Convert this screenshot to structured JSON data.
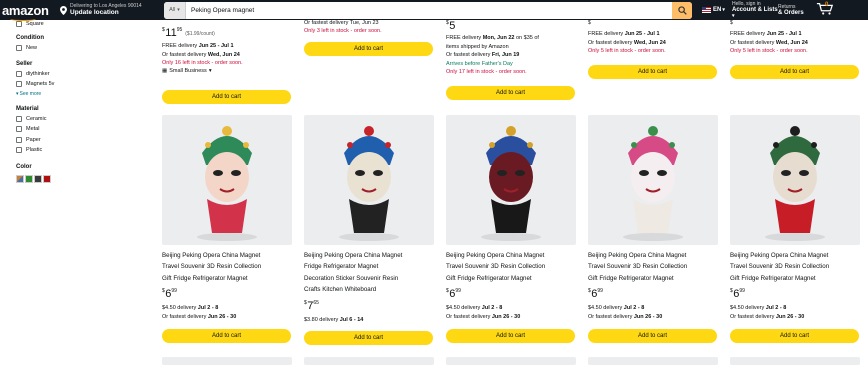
{
  "header": {
    "logo": "amazon",
    "deliver_line1": "Delivering to Los Angeles 90014",
    "deliver_line2": "Update location",
    "search_category": "All",
    "search_value": "Peking Opera magnet",
    "lang": "EN",
    "account_small": "Hello, sign in",
    "account_bold": "Account & Lists",
    "returns_small": "Returns",
    "returns_bold": "& Orders",
    "cart_count": "0"
  },
  "sidebar": {
    "top_item": "Square",
    "condition_heading": "Condition",
    "condition_items": [
      "New"
    ],
    "seller_heading": "Seller",
    "seller_items": [
      "diythinker",
      "Magnets 5v"
    ],
    "see_more": "See more",
    "material_heading": "Material",
    "material_items": [
      "Ceramic",
      "Metal",
      "Paper",
      "Plastic"
    ],
    "color_heading": "Color",
    "colors": [
      "#4a6fa5",
      "#2e8b2e",
      "#3a3a3a",
      "#b01010"
    ]
  },
  "top_row": [
    {
      "price_whole": "11",
      "price_frac": "95",
      "unit_price": "($1.99/count)",
      "line1": "FREE delivery ",
      "line1_bold": "Jun 25 - Jul 1",
      "line2": "Or fastest delivery ",
      "line2_bold": "Wed, Jun 24",
      "stock": "Only 16 left in stock - order soon.",
      "small_business": "Small Business",
      "button": "Add to cart"
    },
    {
      "partial_line": "Or fastest delivery Tue, Jun 23",
      "stock": "Only 3 left in stock - order soon.",
      "button": "Add to cart"
    },
    {
      "line1": "FREE delivery ",
      "line1_bold": "Mon, Jun 22",
      "line1_rest": " on $35 of",
      "line1b": "items shipped by Amazon",
      "line2": "Or fastest delivery ",
      "line2_bold": "Fri, Jun 19",
      "promo": "Arrives before Father's Day",
      "stock": "Only 17 left in stock - order soon.",
      "button": "Add to cart"
    },
    {
      "line1": "FREE delivery ",
      "line1_bold": "Jun 25 - Jul 1",
      "line2": "Or fastest delivery ",
      "line2_bold": "Wed, Jun 24",
      "stock": "Only 5 left in stock - order soon.",
      "button": "Add to cart"
    },
    {
      "line1": "FREE delivery ",
      "line1_bold": "Jun 25 - Jul 1",
      "line2": "Or fastest delivery ",
      "line2_bold": "Wed, Jun 24",
      "stock": "Only 5 left in stock - order soon.",
      "button": "Add to cart"
    }
  ],
  "products": [
    {
      "title_lines": [
        "Beijing Peking Opera China Magnet",
        "Travel Souvenir 3D Resin Collection",
        "Gift Fridge Refrigerator Magnet"
      ],
      "price_whole": "6",
      "price_frac": "99",
      "delivery": "$4.50 delivery ",
      "delivery_bold": "Jul 2 - 8",
      "fast": "Or fastest delivery ",
      "fast_bold": "Jun 26 - 30",
      "button": "Add to cart",
      "mask": {
        "face": "#f3d6c8",
        "hat": "#2f8a5a",
        "body": "#d2334b",
        "accent": "#e7b93c"
      }
    },
    {
      "title_lines": [
        "Beijing Peking Opera China Magnet",
        "Fridge Refrigerator Magnet",
        "Decoration Sticker Souvenir Resin",
        "Crafts Kitchen Whiteboard"
      ],
      "price_whole": "7",
      "price_frac": "65",
      "delivery": "$3.80 delivery ",
      "delivery_bold": "Jul 6 - 14",
      "button": "Add to cart",
      "mask": {
        "face": "#e9e2d2",
        "hat": "#1f5fae",
        "body": "#222222",
        "accent": "#c6232b"
      }
    },
    {
      "title_lines": [
        "Beijing Peking Opera China Magnet",
        "Travel Souvenir 3D Resin Collection",
        "Gift Fridge Refrigerator Magnet"
      ],
      "price_whole": "6",
      "price_frac": "99",
      "delivery": "$4.50 delivery ",
      "delivery_bold": "Jul 2 - 8",
      "fast": "Or fastest delivery ",
      "fast_bold": "Jun 26 - 30",
      "button": "Add to cart",
      "mask": {
        "face": "#6a1a22",
        "hat": "#2a4f9e",
        "body": "#181818",
        "accent": "#d4a22b"
      }
    },
    {
      "title_lines": [
        "Beijing Peking Opera China Magnet",
        "Travel Souvenir 3D Resin Collection",
        "Gift Fridge Refrigerator Magnet"
      ],
      "price_whole": "6",
      "price_frac": "99",
      "delivery": "$4.50 delivery ",
      "delivery_bold": "Jul 2 - 8",
      "fast": "Or fastest delivery ",
      "fast_bold": "Jun 26 - 30",
      "button": "Add to cart",
      "mask": {
        "face": "#f4eef0",
        "hat": "#d64a86",
        "body": "#efe9e4",
        "accent": "#3a8f4a"
      }
    },
    {
      "title_lines": [
        "Beijing Peking Opera China Magnet",
        "Travel Souvenir 3D Resin Collection",
        "Gift Fridge Refrigerator Magnet"
      ],
      "price_whole": "6",
      "price_frac": "99",
      "delivery": "$4.50 delivery ",
      "delivery_bold": "Jul 2 - 8",
      "fast": "Or fastest delivery ",
      "fast_bold": "Jun 26 - 30",
      "button": "Add to cart",
      "mask": {
        "face": "#e7dcd0",
        "hat": "#2e6a3e",
        "body": "#c61d26",
        "accent": "#1e1e1e"
      }
    }
  ]
}
